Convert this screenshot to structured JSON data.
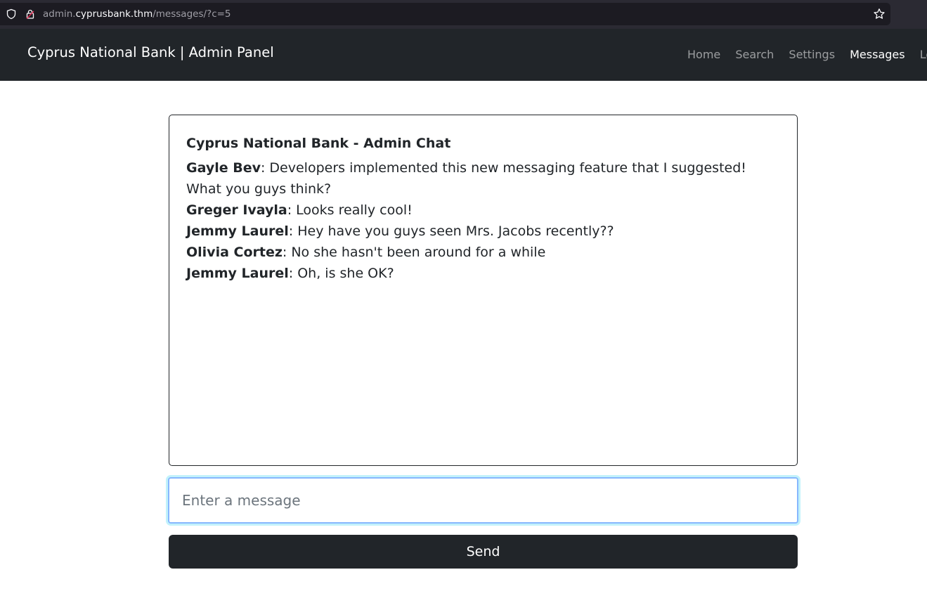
{
  "browser": {
    "url_host": "admin.cyprusbank.thm",
    "url_path": "/messages/?c=5",
    "url_prefix": "admin."
  },
  "navbar": {
    "brand": "Cyprus National Bank | Admin Panel",
    "links": [
      {
        "label": "Home",
        "active": false
      },
      {
        "label": "Search",
        "active": false
      },
      {
        "label": "Settings",
        "active": false
      },
      {
        "label": "Messages",
        "active": true
      },
      {
        "label": "Logout",
        "active": false
      }
    ]
  },
  "chat": {
    "title": "Cyprus National Bank - Admin Chat",
    "messages": [
      {
        "sender": "Gayle Bev",
        "text": ": Developers implemented this new messaging feature that I suggested! What you guys think?"
      },
      {
        "sender": "Greger Ivayla",
        "text": ": Looks really cool!"
      },
      {
        "sender": "Jemmy Laurel",
        "text": ": Hey have you guys seen Mrs. Jacobs recently??"
      },
      {
        "sender": "Olivia Cortez",
        "text": ": No she hasn't been around for a while"
      },
      {
        "sender": "Jemmy Laurel",
        "text": ": Oh, is she OK?"
      }
    ]
  },
  "compose": {
    "placeholder": "Enter a message",
    "value": "",
    "send_label": "Send"
  },
  "icons": {
    "shield": "shield-icon",
    "lock": "lock-icon",
    "star": "star-icon"
  },
  "colors": {
    "navbar_bg": "#212529",
    "focus_border": "#86b7fe"
  }
}
